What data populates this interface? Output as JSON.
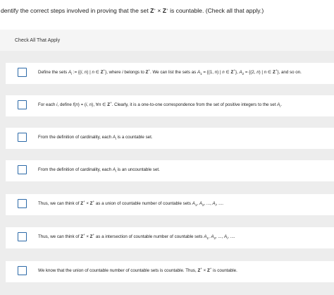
{
  "question": {
    "prefix": "dentify the correct steps involved in proving that the set ",
    "set_a": "Z",
    "sup_a": "+",
    "times": " × ",
    "set_b": "Z",
    "sup_b": "+",
    "suffix": " is countable. (Check all that apply.)"
  },
  "panel": {
    "title": "Check All That Apply"
  },
  "options": [
    {
      "t1": "Define the sets ",
      "a": "A",
      "a_sub": "i",
      "t2": " := {(",
      "i1": "i",
      "t3": ", ",
      "n1": "n",
      "t4": ") | ",
      "n2": "n",
      "t5": " ∈ ",
      "z": "Z",
      "z_sup": "+",
      "t6": "}, where ",
      "i2": "i",
      "t7": " belongs to ",
      "z2": "Z",
      "z2_sup": "+",
      "t8": ". We can list the sets as ",
      "a1": "A",
      "a1_sub": "1",
      "t9": " = {(1, ",
      "n3": "n",
      "t10": ") | ",
      "n4": "n",
      "t11": " ∈ ",
      "z3": "Z",
      "z3_sup": "+",
      "t12": "}, ",
      "a2": "A",
      "a2_sub": "2",
      "t13": " = {(2, ",
      "n5": "n",
      "t14": ") | ",
      "n6": "n",
      "t15": " ∈ ",
      "z4": "Z",
      "z4_sup": "+",
      "t16": "}, and so on."
    },
    {
      "t1": "For each ",
      "i1": "i",
      "t2": ", define ",
      "f": "f",
      "t3": "(",
      "n1": "n",
      "t4": ") = (",
      "i2": "i",
      "t5": ", ",
      "n2": "n",
      "t6": "), ∀",
      "n3": "n",
      "t7": " ∈ ",
      "z": "Z",
      "z_sup": "+",
      "t8": ". Clearly, it is a one-to-one correspondence from the set of positive integers to the set ",
      "a": "A",
      "a_sub": "i",
      "t9": "."
    },
    {
      "t1": "From the definition of cardinality, each ",
      "a": "A",
      "a_sub": "i",
      "t2": " is a countable set."
    },
    {
      "t1": "From the definition of cardinality, each ",
      "a": "A",
      "a_sub": "i",
      "t2": " is an uncountable set."
    },
    {
      "t1": "Thus, we can think of ",
      "z1": "Z",
      "z1_sup": "+",
      "x": " × ",
      "z2": "Z",
      "z2_sup": "+",
      "t2": " as a union of countable number of countable sets ",
      "a1": "A",
      "a1_sub": "1",
      "c1": ", ",
      "a2": "A",
      "a2_sub": "2",
      "c2": ", ..., ",
      "an": "A",
      "an_sub": "i",
      "t3": ", ...."
    },
    {
      "t1": "Thus, we can think of ",
      "z1": "Z",
      "z1_sup": "+",
      "x": " × ",
      "z2": "Z",
      "z2_sup": "+",
      "t2": " as a intersection of countable number of countable sets ",
      "a1": "A",
      "a1_sub": "1",
      "c1": ", ",
      "a2": "A",
      "a2_sub": "2",
      "c2": ", ..., ",
      "an": "A",
      "an_sub": "i",
      "t3": ", ...."
    },
    {
      "t1": "We know that the union of countable number of countable sets is countable. Thus, ",
      "z1": "Z",
      "z1_sup": "+",
      "x": " × ",
      "z2": "Z",
      "z2_sup": "+",
      "t2": " is countable."
    }
  ]
}
